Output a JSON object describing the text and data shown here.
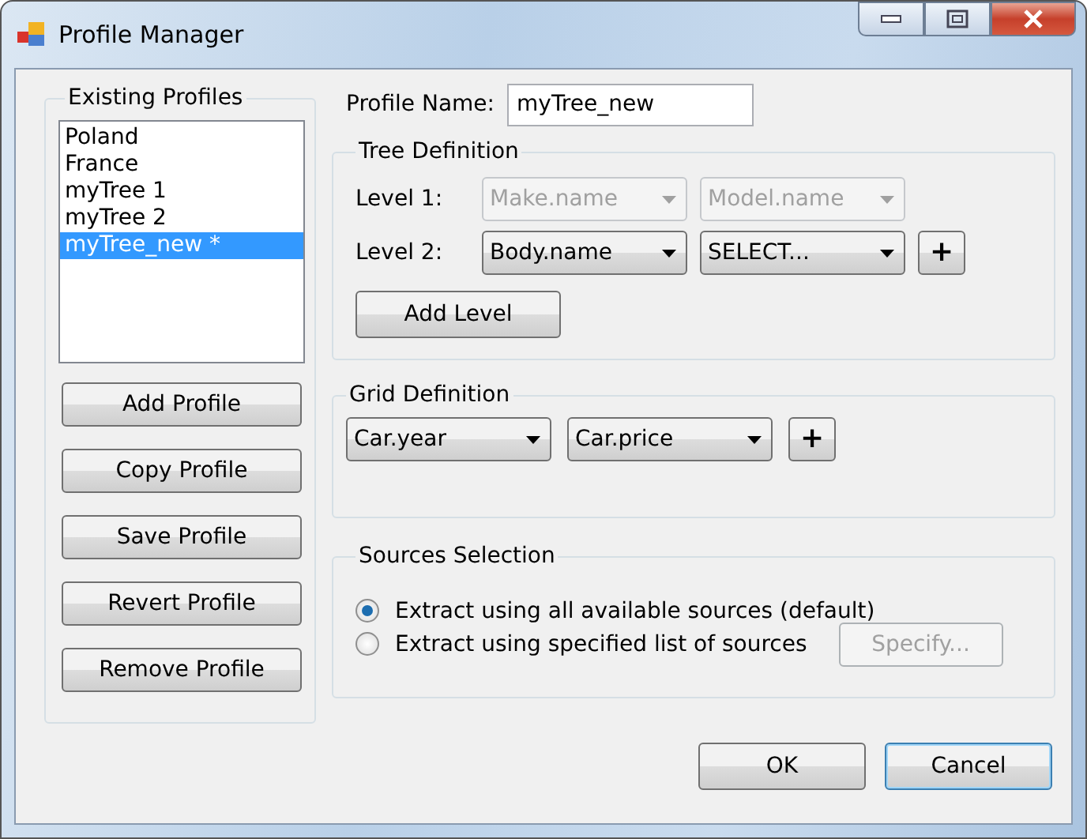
{
  "window": {
    "title": "Profile Manager"
  },
  "profiles": {
    "title": "Existing Profiles",
    "items": [
      {
        "label": "Poland",
        "selected": false
      },
      {
        "label": "France",
        "selected": false
      },
      {
        "label": "myTree 1",
        "selected": false
      },
      {
        "label": "myTree 2",
        "selected": false
      },
      {
        "label": "myTree_new *",
        "selected": true
      }
    ],
    "buttons": [
      "Add Profile",
      "Copy Profile",
      "Save Profile",
      "Revert Profile",
      "Remove Profile"
    ]
  },
  "profile_name": {
    "label": "Profile Name:",
    "value": "myTree_new"
  },
  "tree_definition": {
    "title": "Tree Definition",
    "levels": [
      {
        "label": "Level 1:",
        "disabled": true,
        "fields": [
          "Make.name",
          "Model.name"
        ]
      },
      {
        "label": "Level 2:",
        "disabled": false,
        "fields": [
          "Body.name",
          "SELECT..."
        ],
        "add": "+"
      }
    ],
    "add_level": "Add Level"
  },
  "grid_definition": {
    "title": "Grid Definition",
    "fields": [
      "Car.year",
      "Car.price"
    ],
    "add": "+"
  },
  "sources_selection": {
    "title": "Sources Selection",
    "options": [
      {
        "label": "Extract using all available sources (default)",
        "selected": true
      },
      {
        "label": "Extract using specified list of sources",
        "selected": false
      }
    ],
    "specify": {
      "label": "Specify...",
      "disabled": true
    }
  },
  "footer_buttons": [
    {
      "label": "OK",
      "focused": false
    },
    {
      "label": "Cancel",
      "focused": true
    }
  ]
}
